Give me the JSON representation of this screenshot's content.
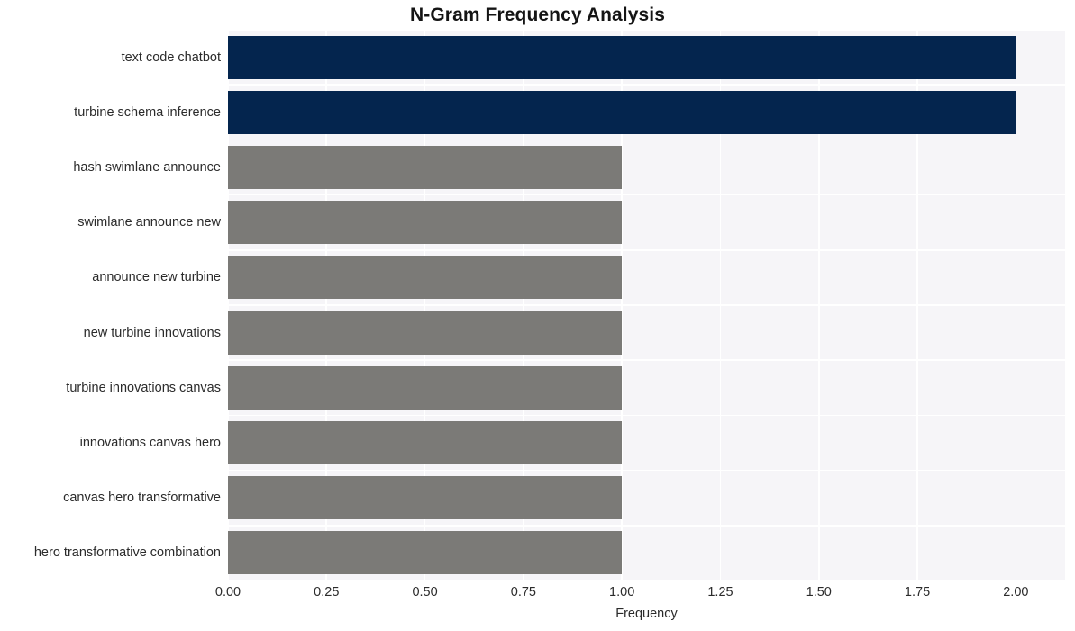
{
  "chart_data": {
    "type": "bar",
    "orientation": "horizontal",
    "title": "N-Gram Frequency Analysis",
    "xlabel": "Frequency",
    "ylabel": "",
    "categories": [
      "text code chatbot",
      "turbine schema inference",
      "hash swimlane announce",
      "swimlane announce new",
      "announce new turbine",
      "new turbine innovations",
      "turbine innovations canvas",
      "innovations canvas hero",
      "canvas hero transformative",
      "hero transformative combination"
    ],
    "values": [
      2,
      2,
      1,
      1,
      1,
      1,
      1,
      1,
      1,
      1
    ],
    "bar_colors": [
      "#04254e",
      "#04254e",
      "#7b7a77",
      "#7b7a77",
      "#7b7a77",
      "#7b7a77",
      "#7b7a77",
      "#7b7a77",
      "#7b7a77",
      "#7b7a77"
    ],
    "xlim": [
      0,
      2.125
    ],
    "xticks": [
      0,
      0.25,
      0.5,
      0.75,
      1,
      1.25,
      1.5,
      1.75,
      2
    ],
    "xtick_labels": [
      "0.00",
      "0.25",
      "0.50",
      "0.75",
      "1.00",
      "1.25",
      "1.50",
      "1.75",
      "2.00"
    ],
    "grid": true,
    "grid_color": "#ffffff",
    "plot_background": "#f6f5f8",
    "figure_background": "#ffffff",
    "legend": null,
    "highlight_color": "#04254e",
    "default_color": "#7b7a77"
  }
}
